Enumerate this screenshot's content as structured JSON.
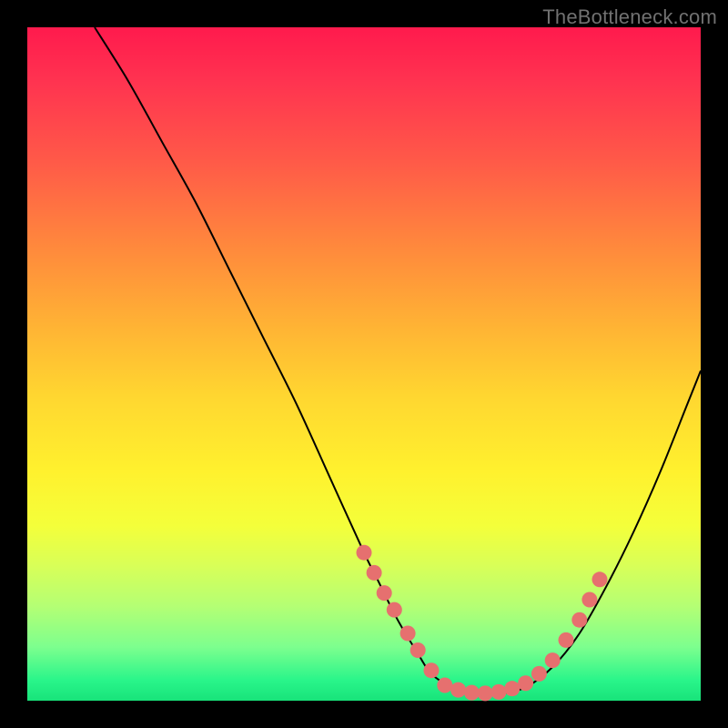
{
  "watermark": "TheBottleneck.com",
  "colors": {
    "frame": "#000000",
    "dot": "#e6706f",
    "curve": "#000000",
    "gradient_stops": [
      "#ff1a4d",
      "#ff5a48",
      "#ffb534",
      "#fff12e",
      "#b4ff74",
      "#18e37a"
    ]
  },
  "chart_data": {
    "type": "line",
    "title": "",
    "xlabel": "",
    "ylabel": "",
    "xlim": [
      0,
      100
    ],
    "ylim": [
      0,
      100
    ],
    "grid": false,
    "legend": false,
    "note": "V-shaped bottleneck curve. y≈0 is optimal (green band at bottom); higher y = worse match. Values are read/estimated from the plot in percent of axis range.",
    "curve": {
      "x": [
        10,
        15,
        20,
        25,
        30,
        35,
        40,
        45,
        50,
        52,
        55,
        58,
        60,
        63,
        66,
        70,
        74,
        78,
        82,
        86,
        90,
        94,
        98,
        100
      ],
      "y": [
        100,
        92,
        83,
        74,
        64,
        54,
        44,
        33,
        22,
        18,
        12,
        7,
        4,
        2,
        1,
        1,
        2,
        5,
        10,
        17,
        25,
        34,
        44,
        49
      ]
    },
    "series": [
      {
        "name": "left-arm-markers",
        "type": "scatter",
        "x": [
          50,
          51.5,
          53,
          54.5,
          56.5,
          58,
          60
        ],
        "y": [
          22,
          19,
          16,
          13.5,
          10,
          7.5,
          4.5
        ]
      },
      {
        "name": "valley-markers",
        "type": "scatter",
        "x": [
          62,
          64,
          66,
          68,
          70,
          72,
          74
        ],
        "y": [
          2.3,
          1.6,
          1.2,
          1.1,
          1.3,
          1.8,
          2.6
        ]
      },
      {
        "name": "right-arm-markers",
        "type": "scatter",
        "x": [
          76,
          78,
          80,
          82,
          83.5,
          85
        ],
        "y": [
          4,
          6,
          9,
          12,
          15,
          18
        ]
      }
    ]
  }
}
